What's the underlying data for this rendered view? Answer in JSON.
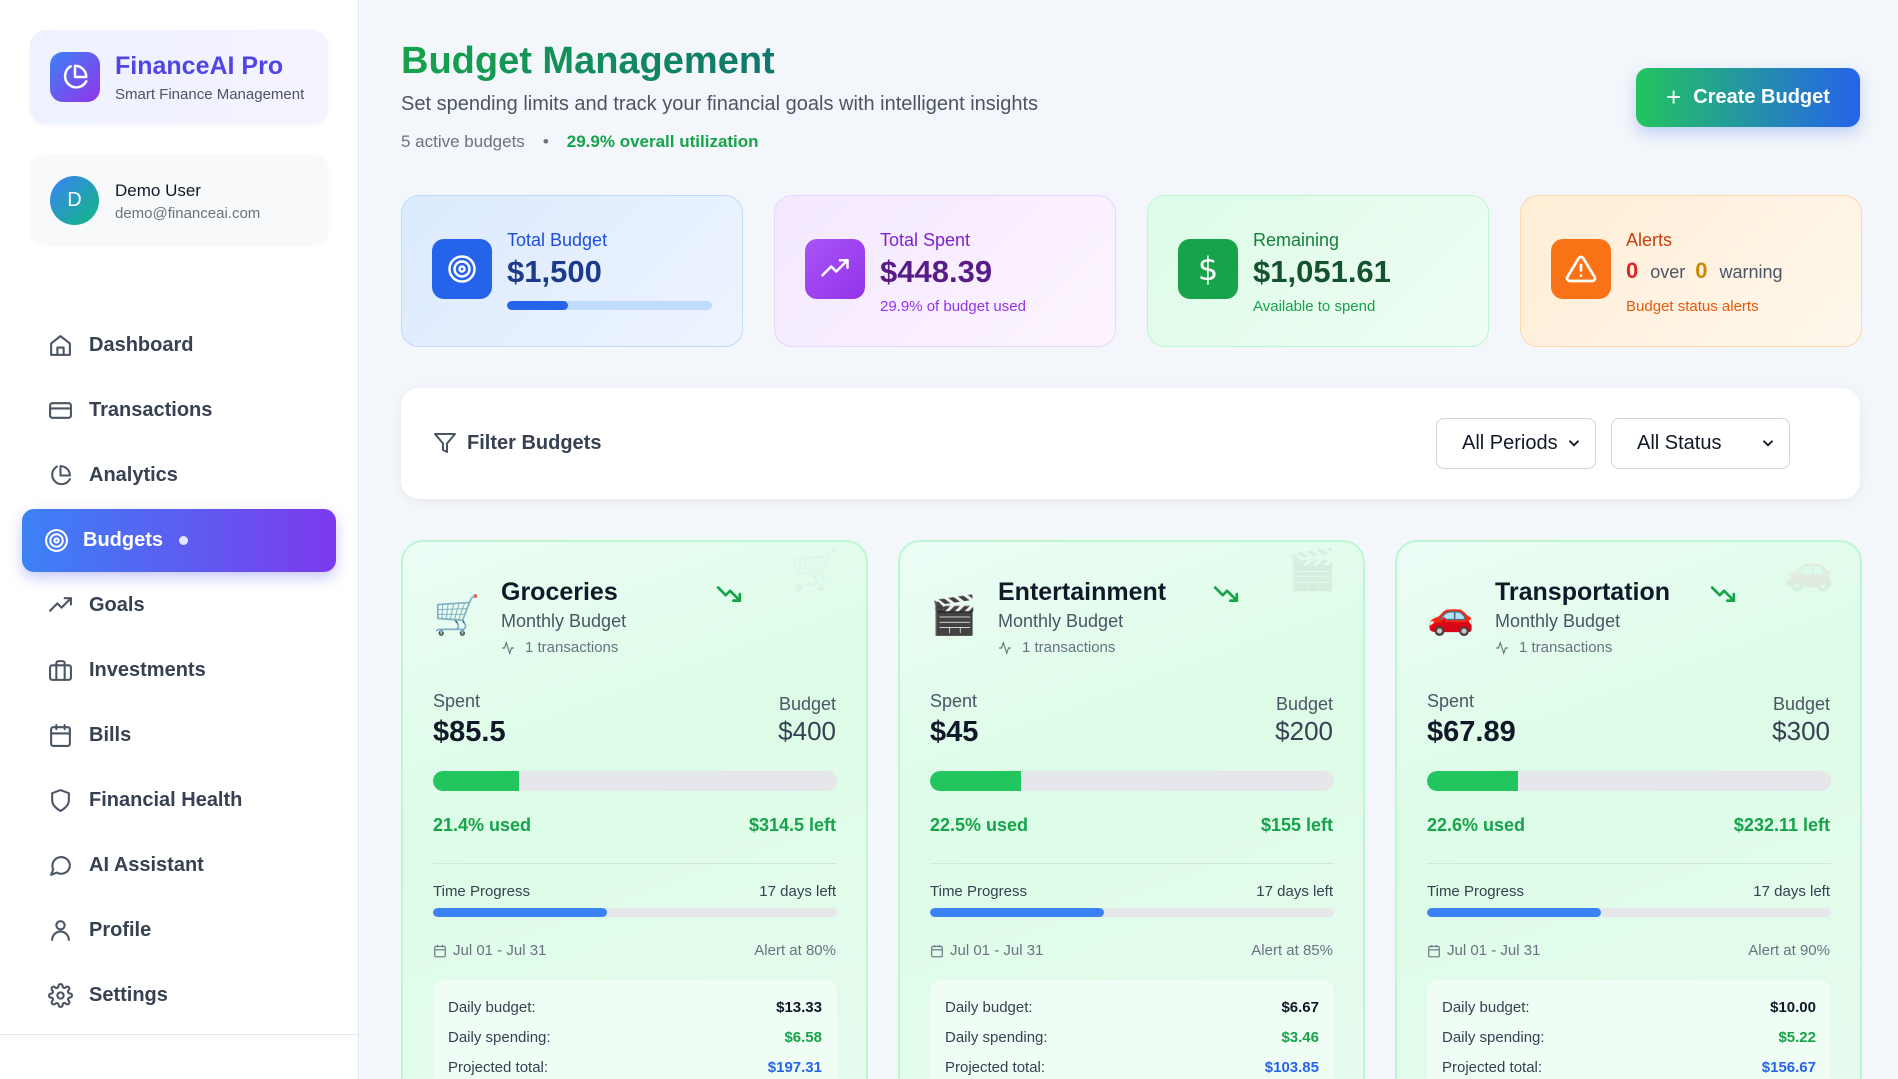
{
  "app": {
    "name": "FinanceAI Pro",
    "tagline": "Smart Finance Management"
  },
  "user": {
    "initial": "D",
    "name": "Demo User",
    "email": "demo@financeai.com"
  },
  "nav": [
    {
      "label": "Dashboard",
      "icon": "home-icon"
    },
    {
      "label": "Transactions",
      "icon": "credit-card-icon"
    },
    {
      "label": "Analytics",
      "icon": "pie-chart-icon"
    },
    {
      "label": "Budgets",
      "icon": "target-icon",
      "active": true
    },
    {
      "label": "Goals",
      "icon": "trending-up-icon"
    },
    {
      "label": "Investments",
      "icon": "briefcase-icon"
    },
    {
      "label": "Bills",
      "icon": "calendar-icon"
    },
    {
      "label": "Financial Health",
      "icon": "shield-icon"
    },
    {
      "label": "AI Assistant",
      "icon": "message-icon"
    },
    {
      "label": "Profile",
      "icon": "user-icon"
    },
    {
      "label": "Settings",
      "icon": "gear-icon"
    }
  ],
  "header": {
    "title": "Budget Management",
    "subtitle": "Set spending limits and track your financial goals with intelligent insights",
    "active_budgets": "5 active budgets",
    "separator": "•",
    "utilization": "29.9% overall utilization",
    "create_button": "Create Budget",
    "create_button_icon": "+"
  },
  "stats": {
    "total_budget": {
      "label": "Total Budget",
      "value": "$1,500",
      "progress": 0.299
    },
    "total_spent": {
      "label": "Total Spent",
      "value": "$448.39",
      "sub": "29.9% of budget used"
    },
    "remaining": {
      "label": "Remaining",
      "value": "$1,051.61",
      "sub": "Available to spend",
      "symbol": "$"
    },
    "alerts": {
      "label": "Alerts",
      "over_count": "0",
      "over_label": "over",
      "warning_count": "0",
      "warning_label": "warning",
      "sub": "Budget status alerts"
    }
  },
  "filter": {
    "title": "Filter Budgets",
    "period_value": "All Periods",
    "status_value": "All Status"
  },
  "budgets": [
    {
      "name": "Groceries",
      "emoji": "🛒",
      "period": "Monthly Budget",
      "transactions": "1 transactions",
      "spent_label": "Spent",
      "spent": "$85.5",
      "budget_label": "Budget",
      "budget": "$400",
      "used_fraction": 0.214,
      "used": "21.4% used",
      "left": "$314.5 left",
      "time_label": "Time Progress",
      "days_left": "17 days left",
      "time_fraction": 0.43,
      "dates": "Jul 01 - Jul 31",
      "alert_at": "Alert at 80%",
      "daily_budget_label": "Daily budget:",
      "daily_budget": "$13.33",
      "daily_spending_label": "Daily spending:",
      "daily_spending": "$6.58",
      "projected_label": "Projected total:",
      "projected": "$197.31"
    },
    {
      "name": "Entertainment",
      "emoji": "🎬",
      "period": "Monthly Budget",
      "transactions": "1 transactions",
      "spent_label": "Spent",
      "spent": "$45",
      "budget_label": "Budget",
      "budget": "$200",
      "used_fraction": 0.225,
      "used": "22.5% used",
      "left": "$155 left",
      "time_label": "Time Progress",
      "days_left": "17 days left",
      "time_fraction": 0.43,
      "dates": "Jul 01 - Jul 31",
      "alert_at": "Alert at 85%",
      "daily_budget_label": "Daily budget:",
      "daily_budget": "$6.67",
      "daily_spending_label": "Daily spending:",
      "daily_spending": "$3.46",
      "projected_label": "Projected total:",
      "projected": "$103.85"
    },
    {
      "name": "Transportation",
      "emoji": "🚗",
      "period": "Monthly Budget",
      "transactions": "1 transactions",
      "spent_label": "Spent",
      "spent": "$67.89",
      "budget_label": "Budget",
      "budget": "$300",
      "used_fraction": 0.226,
      "used": "22.6% used",
      "left": "$232.11 left",
      "time_label": "Time Progress",
      "days_left": "17 days left",
      "time_fraction": 0.43,
      "dates": "Jul 01 - Jul 31",
      "alert_at": "Alert at 90%",
      "daily_budget_label": "Daily budget:",
      "daily_budget": "$10.00",
      "daily_spending_label": "Daily spending:",
      "daily_spending": "$5.22",
      "projected_label": "Projected total:",
      "projected": "$156.67"
    }
  ],
  "colors": {
    "accent_green": "#16a34a",
    "accent_blue": "#2563eb",
    "accent_purple": "#7c3aed",
    "alert_orange": "#ea580c",
    "warning_yellow": "#ca8a04"
  }
}
